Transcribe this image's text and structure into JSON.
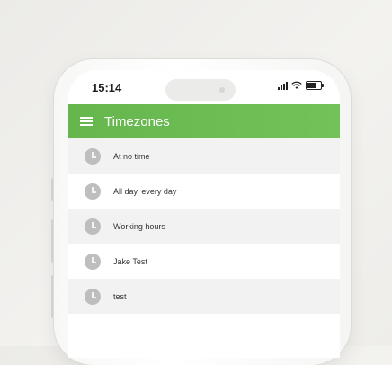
{
  "status_bar": {
    "time": "15:14"
  },
  "app_bar": {
    "title": "Timezones"
  },
  "timezones": [
    {
      "label": "At no time"
    },
    {
      "label": "All day, every day"
    },
    {
      "label": "Working hours"
    },
    {
      "label": "Jake Test"
    },
    {
      "label": "test"
    }
  ],
  "colors": {
    "accent": "#6cbb54",
    "row_alt": "#f2f2f2"
  }
}
